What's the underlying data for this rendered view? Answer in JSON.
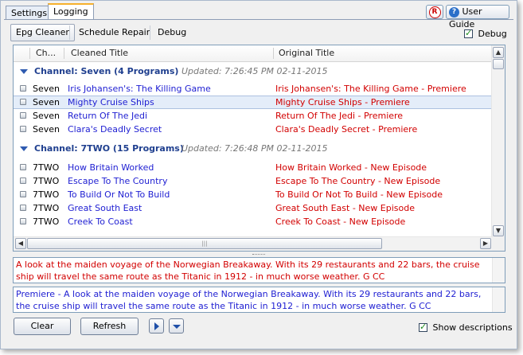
{
  "tabs": [
    {
      "label": "Settings",
      "active": false
    },
    {
      "label": "Logging",
      "active": true
    }
  ],
  "top_buttons": {
    "r_icon_glyph": "R",
    "help_icon_glyph": "?",
    "user_guide_label": "User Guide"
  },
  "subtabs": [
    {
      "label": "Epg Cleaner",
      "active": true
    },
    {
      "label": "Schedule Repair",
      "active": false
    },
    {
      "label": "Debug",
      "active": false
    }
  ],
  "debug_checkbox": {
    "label": "Debug",
    "checked": true
  },
  "grid": {
    "columns": [
      "Ch...",
      "Cleaned Title",
      "Original Title"
    ],
    "groups": [
      {
        "title": "Channel: Seven (4 Programs)",
        "updated": "Updated:  7:26:45 PM  02-11-2015",
        "rows": [
          {
            "channel": "Seven",
            "cleaned": "Iris Johansen's: The Killing Game",
            "original": "Iris Johansen's: The Killing Game - Premiere",
            "selected": false
          },
          {
            "channel": "Seven",
            "cleaned": "Mighty Cruise Ships",
            "original": "Mighty Cruise Ships - Premiere",
            "selected": true
          },
          {
            "channel": "Seven",
            "cleaned": "Return Of The Jedi",
            "original": "Return Of The Jedi - Premiere",
            "selected": false
          },
          {
            "channel": "Seven",
            "cleaned": "Clara's Deadly Secret",
            "original": "Clara's Deadly Secret - Premiere",
            "selected": false
          }
        ]
      },
      {
        "title": "Channel: 7TWO (15 Programs)",
        "updated": "Updated:  7:26:48 PM  02-11-2015",
        "rows": [
          {
            "channel": "7TWO",
            "cleaned": "How Britain Worked",
            "original": "How Britain Worked - New Episode",
            "selected": false
          },
          {
            "channel": "7TWO",
            "cleaned": "Escape To The Country",
            "original": "Escape To The Country - New Episode",
            "selected": false
          },
          {
            "channel": "7TWO",
            "cleaned": "To Build Or Not To Build",
            "original": "To Build Or Not To Build - New Episode",
            "selected": false
          },
          {
            "channel": "7TWO",
            "cleaned": "Great South East",
            "original": "Great South East - New Episode",
            "selected": false
          },
          {
            "channel": "7TWO",
            "cleaned": "Creek To Coast",
            "original": "Creek To Coast - New Episode",
            "selected": false
          }
        ]
      }
    ]
  },
  "descriptions": {
    "original": "A look at the maiden voyage of the Norwegian Breakaway. With its 29 restaurants and 22 bars, the cruise ship will travel the same route as the Titanic in 1912 - in much worse weather. G CC",
    "cleaned": "Premiere - A look at the maiden voyage of the Norwegian Breakaway. With its 29 restaurants and 22 bars, the cruise ship will travel the same route as the Titanic in 1912 - in much worse weather. G CC"
  },
  "bottom": {
    "clear_label": "Clear",
    "refresh_label": "Refresh",
    "show_descriptions_label": "Show descriptions",
    "show_descriptions_checked": true
  },
  "colors": {
    "cleaned_title": "#1e1ed2",
    "original_title": "#d20000",
    "group_header": "#1f3f8f"
  }
}
